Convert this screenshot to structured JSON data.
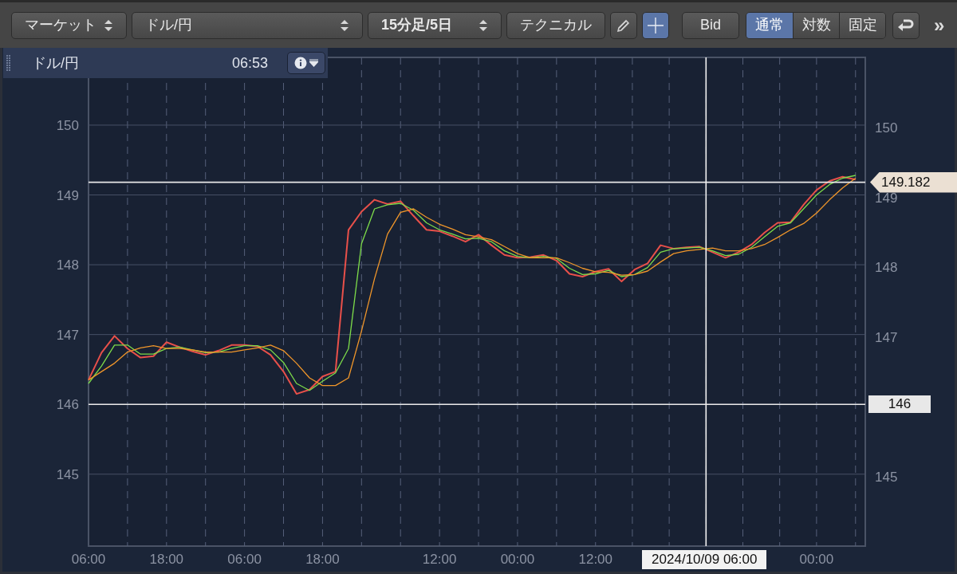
{
  "toolbar": {
    "selects": [
      {
        "value": "マーケット",
        "kind": "short"
      },
      {
        "value": "ドル/円",
        "kind": "wide"
      },
      {
        "value": "15分足/5日",
        "kind": "bold"
      }
    ],
    "technical_button": "テクニカル",
    "tools": [
      {
        "kind": "pencil",
        "selected": false
      },
      {
        "kind": "crosshair",
        "selected": true
      }
    ],
    "price_button": "Bid",
    "scale_modes": [
      {
        "label": "通常",
        "selected": true
      },
      {
        "label": "対数",
        "selected": false
      },
      {
        "label": "固定",
        "selected": false
      }
    ],
    "more": "»"
  },
  "panel": {
    "title": "ドル/円",
    "time": "06:53"
  },
  "chart_data": {
    "type": "line",
    "categories": [
      "06:00",
      null,
      null,
      null,
      null,
      null,
      "18:00",
      null,
      null,
      null,
      null,
      null,
      "06:00",
      null,
      null,
      null,
      null,
      null,
      "18:00",
      null,
      null,
      null,
      null,
      null,
      null,
      null,
      null,
      "12:00",
      null,
      null,
      null,
      null,
      null,
      "00:00",
      null,
      null,
      null,
      null,
      null,
      "12:00",
      null,
      null,
      null,
      null,
      null,
      null,
      null,
      null,
      null,
      null,
      null,
      null,
      null,
      null,
      null,
      null,
      "00:00",
      null,
      null,
      null
    ],
    "series": [
      {
        "color": "#e8504a",
        "values": [
          146.35,
          146.74,
          146.98,
          146.8,
          146.67,
          146.69,
          146.89,
          146.82,
          146.76,
          146.71,
          146.77,
          146.85,
          146.85,
          146.83,
          146.71,
          146.47,
          146.15,
          146.21,
          146.4,
          146.47,
          148.5,
          148.76,
          148.93,
          148.87,
          148.91,
          148.7,
          148.5,
          148.48,
          148.41,
          148.33,
          148.43,
          148.28,
          148.14,
          148.1,
          148.11,
          148.14,
          148.06,
          147.87,
          147.83,
          147.9,
          147.94,
          147.76,
          147.93,
          148.02,
          148.28,
          148.23,
          148.25,
          148.26,
          148.18,
          148.1,
          148.18,
          148.29,
          148.46,
          148.6,
          148.61,
          148.86,
          149.07,
          149.2,
          149.26,
          149.22
        ]
      },
      {
        "color": "#7ddc4a",
        "values": [
          146.3,
          146.55,
          146.85,
          146.85,
          146.72,
          146.72,
          146.8,
          146.82,
          146.78,
          146.74,
          146.75,
          146.8,
          146.84,
          146.84,
          146.78,
          146.6,
          146.3,
          146.2,
          146.33,
          146.45,
          146.8,
          148.3,
          148.8,
          148.86,
          148.88,
          148.78,
          148.6,
          148.5,
          148.44,
          148.37,
          148.38,
          148.33,
          148.2,
          148.12,
          148.1,
          148.12,
          148.09,
          147.95,
          147.86,
          147.87,
          147.92,
          147.83,
          147.86,
          147.96,
          148.18,
          148.23,
          148.24,
          148.25,
          148.2,
          148.13,
          148.15,
          148.25,
          148.4,
          148.55,
          148.6,
          148.8,
          149.0,
          149.15,
          149.24,
          149.28
        ]
      },
      {
        "color": "#f0962a",
        "values": [
          146.35,
          146.47,
          146.59,
          146.75,
          146.81,
          146.84,
          146.8,
          146.8,
          146.78,
          146.75,
          146.75,
          146.75,
          146.78,
          146.81,
          146.85,
          146.77,
          146.59,
          146.38,
          146.27,
          146.27,
          146.38,
          147.05,
          147.8,
          148.44,
          148.75,
          148.8,
          148.68,
          148.58,
          148.51,
          148.43,
          148.4,
          148.36,
          148.26,
          148.16,
          148.1,
          148.1,
          148.1,
          148.03,
          147.95,
          147.9,
          147.89,
          147.85,
          147.86,
          147.91,
          148.04,
          148.16,
          148.2,
          148.22,
          148.24,
          148.2,
          148.2,
          148.23,
          148.29,
          148.39,
          148.5,
          148.59,
          148.74,
          148.93,
          149.1,
          149.24
        ]
      }
    ],
    "ylim": [
      143.97,
      150.97
    ],
    "grid": true,
    "yticks": [
      145,
      146,
      147,
      148,
      149,
      150
    ],
    "ref_lines": [
      {
        "axis": "y",
        "value": 149.182,
        "label": "149.182"
      },
      {
        "axis": "y",
        "value": 146,
        "label": "146"
      }
    ]
  },
  "crosshair": {
    "time": "2024/10/09 06:00"
  },
  "right_axis_labels": [
    "150",
    "149",
    "148",
    "147",
    "145"
  ]
}
